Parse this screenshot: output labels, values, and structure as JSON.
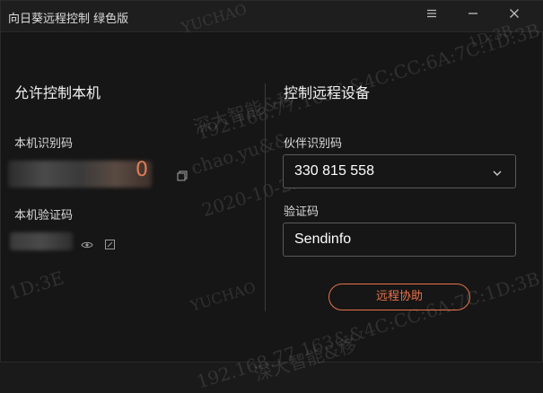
{
  "window": {
    "title": "向日葵远程控制 绿色版"
  },
  "titlebar": {
    "menu_icon": "menu-icon",
    "minimize_icon": "minimize-icon",
    "close_icon": "close-icon"
  },
  "left": {
    "heading": "允许控制本机",
    "id_label": "本机识别码",
    "id_visible_fragment": "0",
    "code_label": "本机验证码"
  },
  "right": {
    "heading": "控制远程设备",
    "partner_label": "伙伴识别码",
    "partner_value": "330 815 558",
    "code_label": "验证码",
    "code_value": "Sendinfo",
    "assist_button": "远程协助"
  },
  "watermarks": {
    "w1": "YUCHAO",
    "w2": "1D:3B",
    "w3": "192.168.77.163&&4C:CC:6A:7C:1D:3B",
    "w4": "深大智能&移",
    "w5": "chao.yu&&",
    "w6": "2020-10-22",
    "w7": "1D:3E",
    "w8": "YUCHAO",
    "w9": "192.168.77.163&&4C:CC:6A:7C:1D:3B",
    "w10": "深大智能&移"
  },
  "colors": {
    "accent": "#e8734a",
    "background": "#161616",
    "border": "#5a5a5a"
  }
}
